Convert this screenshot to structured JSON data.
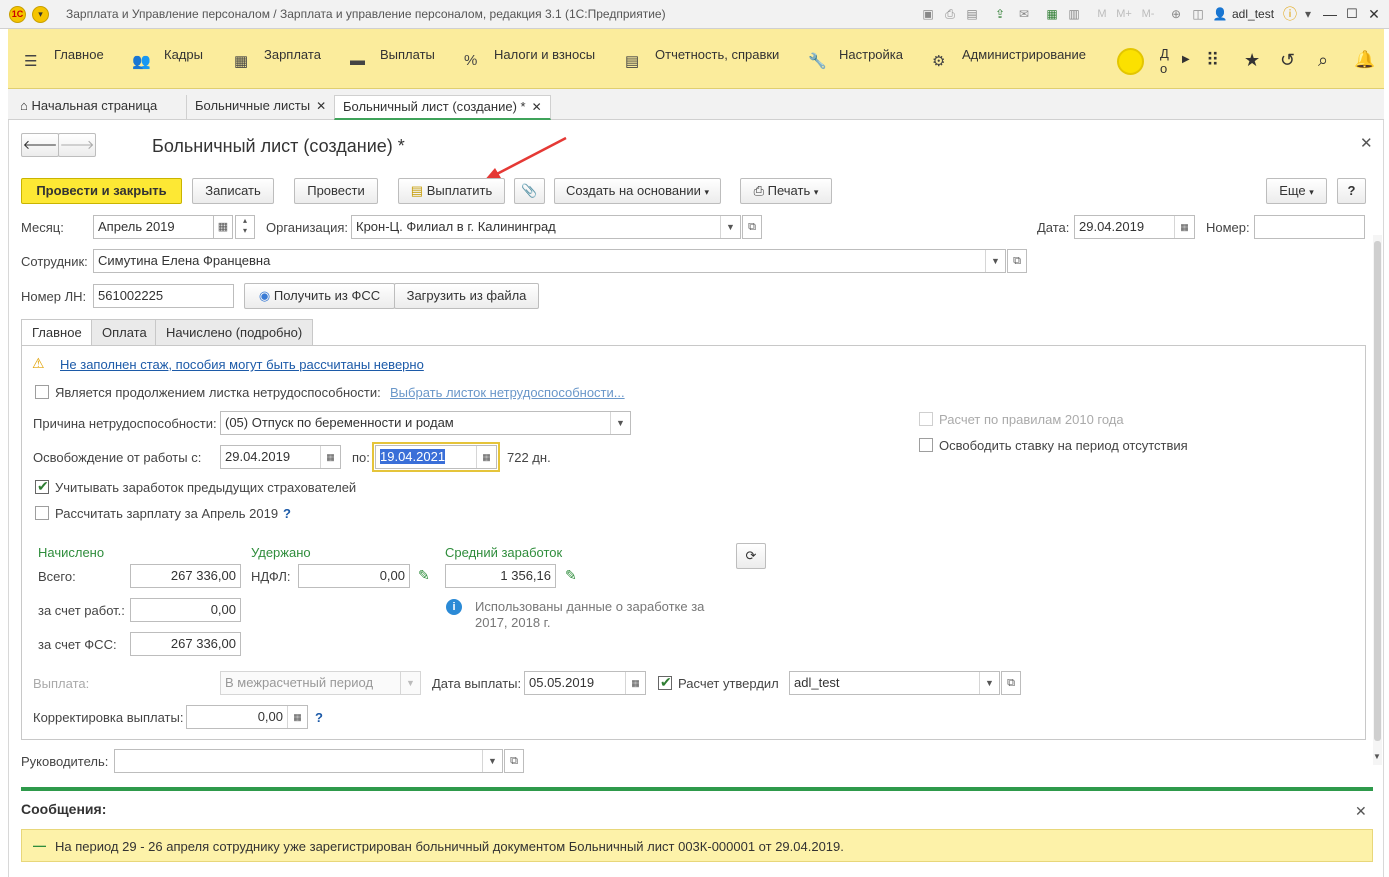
{
  "window": {
    "title": "Зарплата и Управление персоналом / Зарплата и управление персоналом, редакция 3.1 (1С:Предприятие)",
    "user": "adl_test"
  },
  "menu": {
    "items": [
      "Главное",
      "Кадры",
      "Зарплата",
      "Выплаты",
      "Налоги и взносы",
      "Отчетность, справки",
      "Настройка",
      "Администрирование"
    ],
    "truncated": "До до"
  },
  "tabs": {
    "home": "Начальная страница",
    "list": "Больничные листы",
    "doc": "Больничный лист (создание) *"
  },
  "form": {
    "title": "Больничный лист (создание) *",
    "buttons": {
      "post_close": "Провести и закрыть",
      "save": "Записать",
      "post": "Провести",
      "pay": "Выплатить",
      "create_basis": "Создать на основании",
      "print": "Печать",
      "more": "Еще",
      "help": "?"
    },
    "month_label": "Месяц:",
    "month_value": "Апрель 2019",
    "org_label": "Организация:",
    "org_value": "Крон-Ц. Филиал в г. Калининград",
    "date_label": "Дата:",
    "date_value": "29.04.2019",
    "number_label": "Номер:",
    "number_value": "",
    "employee_label": "Сотрудник:",
    "employee_value": "Симутина Елена Францевна",
    "ln_label": "Номер ЛН:",
    "ln_value": "561002225",
    "get_fss": "Получить из ФСС",
    "load_file": "Загрузить из файла",
    "inner_tabs": [
      "Главное",
      "Оплата",
      "Начислено (подробно)"
    ],
    "warning": "Не заполнен стаж, пособия могут быть рассчитаны неверно",
    "continuation_label": "Является продолжением листка нетрудоспособности:",
    "continuation_link": "Выбрать листок нетрудоспособности...",
    "rules_2010": "Расчет по правилам 2010 года",
    "free_rate": "Освободить ставку на период отсутствия",
    "reason_label": "Причина нетрудоспособности:",
    "reason_value": "(05) Отпуск по беременности и родам",
    "release_label": "Освобождение от работы с:",
    "release_from": "29.04.2019",
    "release_to_label": "по:",
    "release_to": "19.04.2021",
    "days": "722 дн.",
    "prev_insurers": "Учитывать заработок предыдущих страхователей",
    "calc_salary": "Рассчитать зарплату за Апрель 2019",
    "q": "?",
    "accrued_head": "Начислено",
    "total_label": "Всего:",
    "total_value": "267 336,00",
    "employer_label": "за счет работ.:",
    "employer_value": "0,00",
    "fss_label": "за счет ФСС:",
    "fss_value": "267 336,00",
    "withheld_head": "Удержано",
    "ndfl_label": "НДФЛ:",
    "ndfl_value": "0,00",
    "avg_head": "Средний заработок",
    "avg_value": "1 356,16",
    "info_text_1": "Использованы данные о заработке за",
    "info_text_2": "2017,   2018 г.",
    "payout_label": "Выплата:",
    "payout_value": "В межрасчетный период",
    "pay_date_label": "Дата выплаты:",
    "pay_date_value": "05.05.2019",
    "approved_label": "Расчет утвердил",
    "approved_value": "adl_test",
    "correction_label": "Корректировка выплаты:",
    "correction_value": "0,00",
    "manager_label": "Руководитель:",
    "manager_value": ""
  },
  "messages": {
    "title": "Сообщения:",
    "text": "На период 29 - 26 апреля сотруднику уже зарегистрирован больничный документом Больничный лист 003К-000001 от 29.04.2019."
  },
  "colors": {
    "menu_bg": "#fbec9c",
    "primary_button": "#fde834",
    "accent_green": "#2f8d3c",
    "message_bg": "#fdf2a9",
    "arrow_red": "#e53935"
  }
}
